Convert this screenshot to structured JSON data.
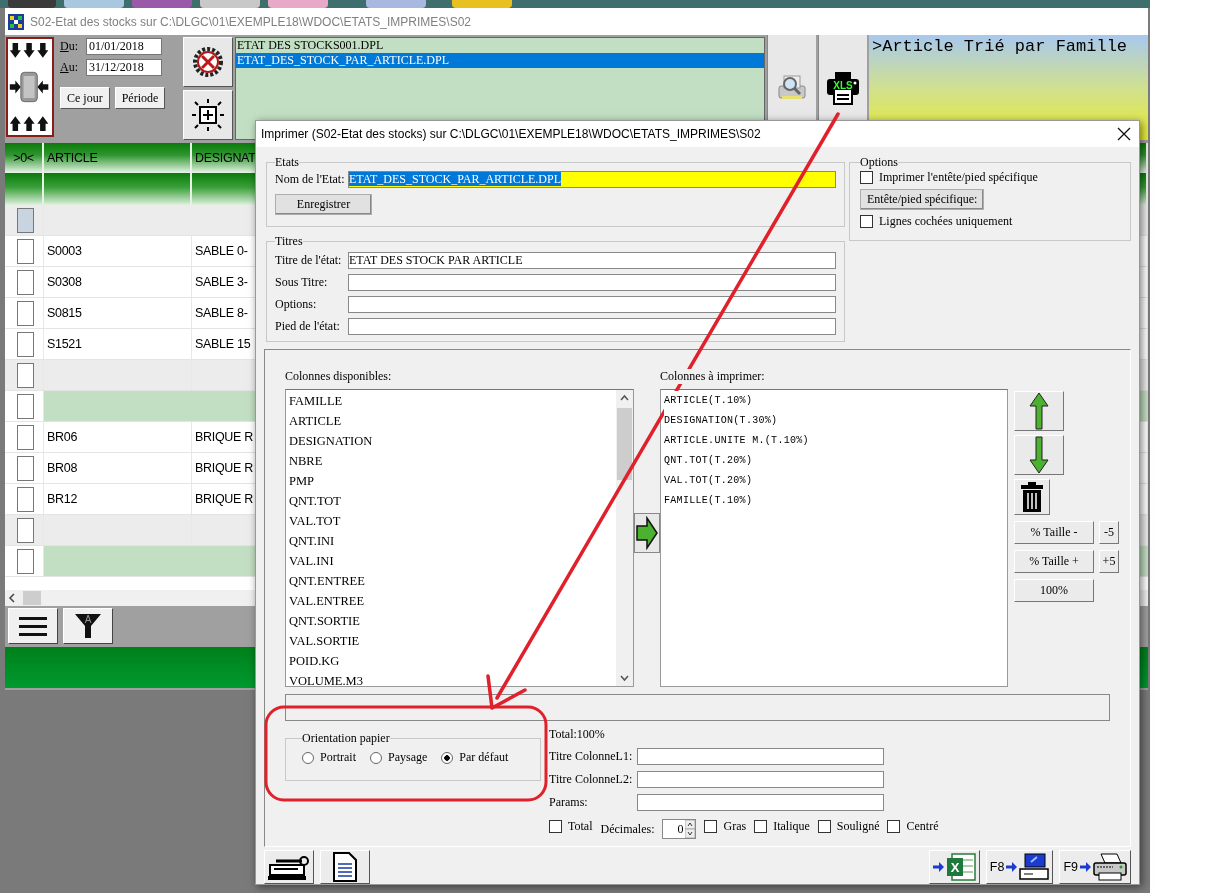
{
  "window": {
    "title": "S02-Etat des stocks sur C:\\DLGC\\01\\EXEMPLE18\\WDOC\\ETATS_IMPRIMES\\S02"
  },
  "period": {
    "from_label": "Du:",
    "from_value": "01/01/2018",
    "to_label": "Au:",
    "to_value": "31/12/2018",
    "buttons": [
      "Ce jour",
      "Période"
    ]
  },
  "report_files": [
    {
      "name": "ETAT DES STOCKS001.DPL",
      "selected": false
    },
    {
      "name": "ETAT_DES_STOCK_PAR_ARTICLE.DPL",
      "selected": true
    }
  ],
  "xls_badge": "XLS",
  "sort_info": ">Article Trié par Famille",
  "grid": {
    "columns": [
      ">0<",
      "ARTICLE",
      "DESIGNAT"
    ],
    "rows": [
      {
        "kind": "current",
        "checked": false
      },
      {
        "kind": "item",
        "checked": false,
        "article": "S0003",
        "designation": "SABLE 0-"
      },
      {
        "kind": "item",
        "checked": false,
        "article": "S0308",
        "designation": "SABLE 3-"
      },
      {
        "kind": "item",
        "checked": false,
        "article": "S0815",
        "designation": "SABLE 8-"
      },
      {
        "kind": "item",
        "checked": false,
        "article": "S1521",
        "designation": "SABLE 15"
      },
      {
        "kind": "separator",
        "checked": false
      },
      {
        "kind": "group",
        "checked": false
      },
      {
        "kind": "item",
        "checked": false,
        "article": "BR06",
        "designation": "BRIQUE R"
      },
      {
        "kind": "item",
        "checked": false,
        "article": "BR08",
        "designation": "BRIQUE R"
      },
      {
        "kind": "item",
        "checked": false,
        "article": "BR12",
        "designation": "BRIQUE R"
      },
      {
        "kind": "separator",
        "checked": false
      },
      {
        "kind": "group",
        "checked": false
      }
    ]
  },
  "filter_letter": "A",
  "dialog": {
    "title": "Imprimer (S02-Etat des stocks)  sur C:\\DLGC\\01\\EXEMPLE18\\WDOC\\ETATS_IMPRIMES\\S02",
    "etats": {
      "legend": "Etats",
      "name_label": "Nom de l'Etat:",
      "name_value": "ETAT_DES_STOCK_PAR_ARTICLE.DPL",
      "save_button": "Enregistrer"
    },
    "options": {
      "legend": "Options",
      "items": [
        {
          "kind": "checkbox",
          "label": "Imprimer l'entête/pied spécifique",
          "checked": false
        },
        {
          "kind": "button",
          "label": "Entête/pied spécifique:"
        },
        {
          "kind": "checkbox",
          "label": "Lignes cochées uniquement",
          "checked": false
        }
      ]
    },
    "titles": {
      "legend": "Titres",
      "fields": [
        {
          "label": "Titre de l'état:",
          "value": "ETAT DES STOCK PAR ARTICLE"
        },
        {
          "label": "Sous Titre:"
        },
        {
          "label": "Options:"
        },
        {
          "label": "Pied de l'état:"
        }
      ]
    },
    "available": {
      "label": "Colonnes disponibles:",
      "items": [
        "FAMILLE",
        "ARTICLE",
        "DESIGNATION",
        "NBRE",
        "PMP",
        "QNT.TOT",
        "VAL.TOT",
        "QNT.INI",
        "VAL.INI",
        "QNT.ENTREE",
        "VAL.ENTREE",
        "QNT.SORTIE",
        "VAL.SORTIE",
        "POID.KG",
        "VOLUME.M3"
      ]
    },
    "to_print": {
      "label": "Colonnes à imprimer:",
      "items": [
        "ARTICLE(T.10%)",
        "DESIGNATION(T.30%)",
        "ARTICLE.UNITE M.(T.10%)",
        "QNT.TOT(T.20%)",
        "VAL.TOT(T.20%)",
        "FAMILLE(T.10%)"
      ]
    },
    "size_buttons": [
      {
        "label": "% Taille -",
        "step": "-5"
      },
      {
        "label": "% Taille +",
        "step": "+5"
      },
      {
        "label": "100%"
      }
    ],
    "orientation": {
      "legend": "Orientation papier",
      "options": [
        {
          "label": "Portrait",
          "selected": false
        },
        {
          "label": "Paysage",
          "selected": false
        },
        {
          "label": "Par défaut",
          "selected": true
        }
      ]
    },
    "total": "Total:100%",
    "column_fields": [
      {
        "label": "Titre ColonneL1:"
      },
      {
        "label": "Titre ColonneL2:"
      },
      {
        "label": "Params:"
      }
    ],
    "format": {
      "total": {
        "label": "Total",
        "checked": false
      },
      "decimals_label": "Décimales:",
      "decimals_value": "0",
      "styles": [
        {
          "label": "Gras",
          "checked": false
        },
        {
          "label": "Italique",
          "checked": false
        },
        {
          "label": "Souligné",
          "checked": false
        },
        {
          "label": "Centré",
          "checked": false
        }
      ]
    },
    "footer_buttons": [
      {
        "kind": "excel",
        "mark": "X"
      },
      {
        "kind": "screen",
        "key": "F8"
      },
      {
        "kind": "printer",
        "key": "F9"
      }
    ]
  }
}
